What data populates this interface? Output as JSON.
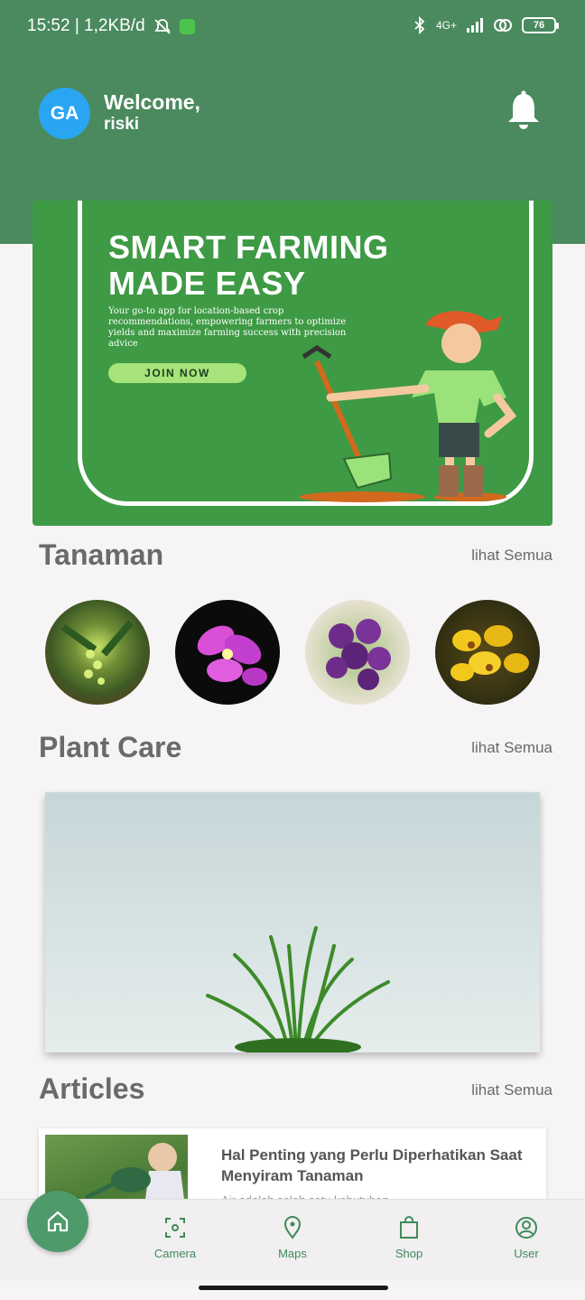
{
  "status_bar": {
    "time_speed": "15:52 | 1,2KB/d",
    "network": "4G+",
    "battery": "76"
  },
  "header": {
    "avatar_initials": "GA",
    "welcome": "Welcome,",
    "username": "riski"
  },
  "banner": {
    "title_line1": "SMART FARMING",
    "title_line2": "MADE EASY",
    "subtitle": "Your go-to app for location-based crop recommendations, empowering farmers to optimize yields and maximize farming success with precision advice",
    "cta": "JOIN NOW"
  },
  "sections": {
    "tanaman": {
      "title": "Tanaman",
      "see_all": "lihat Semua"
    },
    "plant_care": {
      "title": "Plant Care",
      "see_all": "lihat Semua"
    },
    "articles": {
      "title": "Articles",
      "see_all": "lihat Semua"
    }
  },
  "plants": [
    "plant-green-orchid",
    "plant-pink-orchid",
    "plant-purple-orchid",
    "plant-yellow-orchid"
  ],
  "article": {
    "title": "Hal Penting yang Perlu Diperhatikan Saat Menyiram Tanaman",
    "excerpt": "Air adalah salah satu kebutuhan..."
  },
  "nav": {
    "camera": "Camera",
    "maps": "Maps",
    "shop": "Shop",
    "user": "User"
  },
  "colors": {
    "primary": "#4a8a5e",
    "banner": "#3e9a44",
    "avatar": "#2aa5f2",
    "nav_accent": "#3f8a5c"
  }
}
